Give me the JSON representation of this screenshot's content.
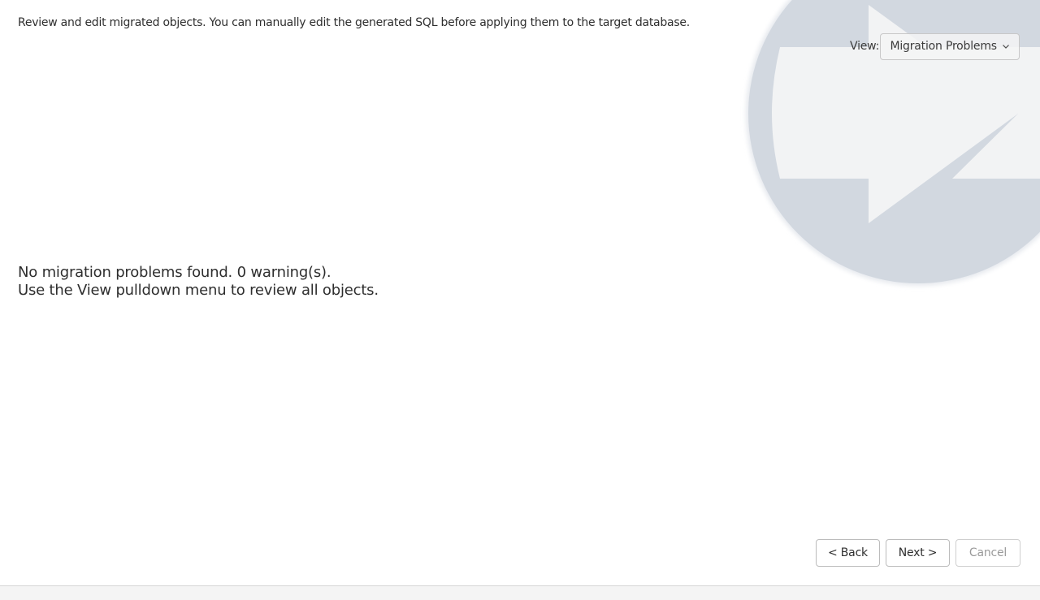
{
  "instructions": "Review and edit migrated objects. You can manually edit the generated SQL before applying them to the target database.",
  "view": {
    "label": "View:",
    "selected": "Migration Problems"
  },
  "status": {
    "line1": "No migration problems found. 0 warning(s).",
    "line2": "Use the View pulldown menu to review all objects."
  },
  "buttons": {
    "back": "< Back",
    "next": "Next >",
    "cancel": "Cancel"
  },
  "colors": {
    "watermark_circle": "#d2d8e0",
    "watermark_arrow": "#f2f3f4",
    "page_bg": "#ffffff",
    "footer_bg": "#f4f4f4"
  },
  "icons": {
    "watermark": "migration-arrow-logo-icon",
    "dropdown": "chevron-down-icon"
  }
}
